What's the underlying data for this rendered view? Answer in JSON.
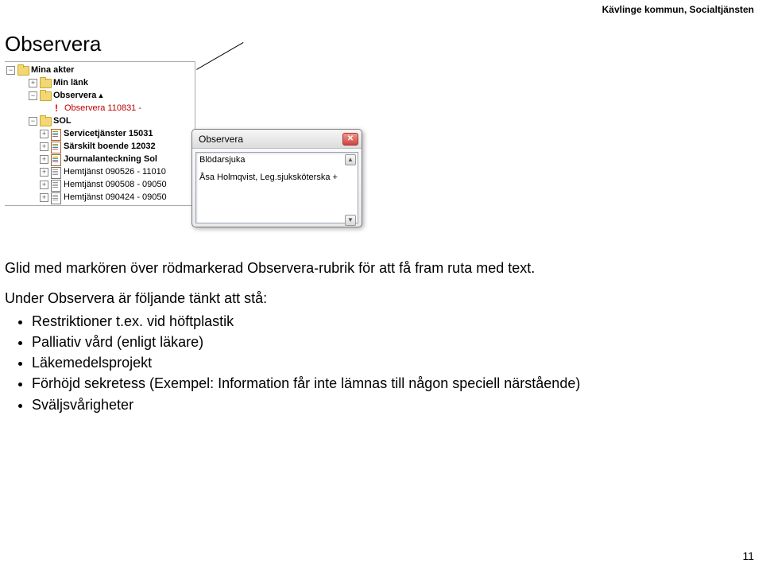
{
  "header": {
    "right": "Kävlinge kommun, Socialtjänsten"
  },
  "title": "Observera",
  "tree": {
    "rows": [
      {
        "pm": "-",
        "indent": 0,
        "icon": "folder",
        "label": "Mina akter",
        "bold": true
      },
      {
        "pm": "+",
        "indent": 1,
        "icon": "folder",
        "label": "Min länk",
        "bold": true
      },
      {
        "pm": "-",
        "indent": 1,
        "icon": "folder",
        "label": "Observera",
        "bold": true,
        "marker": true
      },
      {
        "pm": "",
        "indent": 2,
        "icon": "excl",
        "label": "Observera 110831 -",
        "bold": false,
        "red": true
      },
      {
        "pm": "-",
        "indent": 1,
        "icon": "folder",
        "label": "SOL",
        "bold": true
      },
      {
        "pm": "+",
        "indent": 2,
        "icon": "doc-color",
        "label": "Servicetjänster 15031",
        "bold": true
      },
      {
        "pm": "+",
        "indent": 2,
        "icon": "doc-color",
        "label": "Särskilt boende 12032",
        "bold": true
      },
      {
        "pm": "+",
        "indent": 2,
        "icon": "doc-color",
        "label": "Journalanteckning Sol",
        "bold": true
      },
      {
        "pm": "+",
        "indent": 2,
        "icon": "doc",
        "label": "Hemtjänst 090526 - 11010",
        "bold": false
      },
      {
        "pm": "+",
        "indent": 2,
        "icon": "doc",
        "label": "Hemtjänst 090508 - 09050",
        "bold": false
      },
      {
        "pm": "+",
        "indent": 2,
        "icon": "doc",
        "label": "Hemtjänst 090424 - 09050",
        "bold": false
      }
    ]
  },
  "popup": {
    "title": "Observera",
    "line1": "Blödarsjuka",
    "line2": "Åsa Holmqvist, Leg.sjuksköterska +"
  },
  "body": {
    "p1": "Glid med markören över rödmarkerad Observera-rubrik för att få fram ruta med text.",
    "p2": "Under Observera är följande tänkt att stå:",
    "bullets": [
      "Restriktioner t.ex. vid höftplastik",
      "Palliativ vård (enligt läkare)",
      "Läkemedelsprojekt",
      "Förhöjd sekretess (Exempel: Information får inte lämnas till någon speciell närstående)",
      "Sväljsvårigheter"
    ]
  },
  "pagenum": "11"
}
